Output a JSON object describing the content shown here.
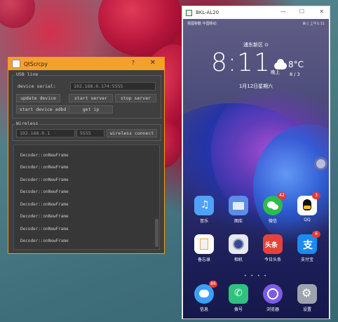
{
  "qt": {
    "title": "QtScrcpy",
    "help": "?",
    "close": "✕",
    "usb_group": "USB line",
    "serial_label": "device serial:",
    "serial_value": "192.168.0.174:5555",
    "update_device": "update device",
    "start_server": "start server",
    "stop_server": "stop server",
    "start_adbd": "start device adbd",
    "get_ip": "get ip",
    "wireless_group": "Wireless",
    "ip_value": "192.168.0.1",
    "port_value": "5555",
    "wireless_connect": "wireless connect",
    "log_lines": [
      "Decoder::onNewFrame",
      "Decoder::onNewFrame",
      "Decoder::onNewFrame",
      "Decoder::onNewFrame",
      "Decoder::onNewFrame",
      "Decoder::onNewFrame",
      "Decoder::onNewFrame",
      "Decoder::onNewFrame"
    ]
  },
  "phone": {
    "title": "BKL-AL20",
    "minimize": "—",
    "maximize": "☐",
    "close": "✕",
    "status_left": "我國移動 中国移动",
    "status_right": "⊠ ▯ 上午1:11",
    "city": "浦东新区 ⊙",
    "clock": "8:11",
    "ampm": "晚上",
    "temp": "8°C",
    "temp_range": "8 / 3",
    "date": "1月12日星期六",
    "page_dots": "• • • •",
    "apps_row1": [
      {
        "label": "音乐",
        "color": "#4fa3f7",
        "badge": ""
      },
      {
        "label": "图库",
        "color": "#5b8de6",
        "badge": ""
      },
      {
        "label": "微信",
        "color": "#2dbb4d",
        "badge": "42"
      },
      {
        "label": "QQ",
        "color": "#ffffff",
        "badge": "3"
      }
    ],
    "apps_row2": [
      {
        "label": "备忘录",
        "color": "#ffffff",
        "badge": ""
      },
      {
        "label": "相机",
        "color": "#e8e8ee",
        "badge": ""
      },
      {
        "label": "今日头条",
        "color": "#e8413a",
        "badge": ""
      },
      {
        "label": "支付宝",
        "color": "#1a8cf0",
        "badge": "6"
      }
    ],
    "dock": [
      {
        "label": "信息",
        "color": "#3ba0f5",
        "badge": "86"
      },
      {
        "label": "拨号",
        "color": "#2ec27e",
        "badge": ""
      },
      {
        "label": "浏览器",
        "color": "#7b5ce6",
        "badge": ""
      },
      {
        "label": "设置",
        "color": "#9ea4ad",
        "badge": ""
      }
    ]
  }
}
